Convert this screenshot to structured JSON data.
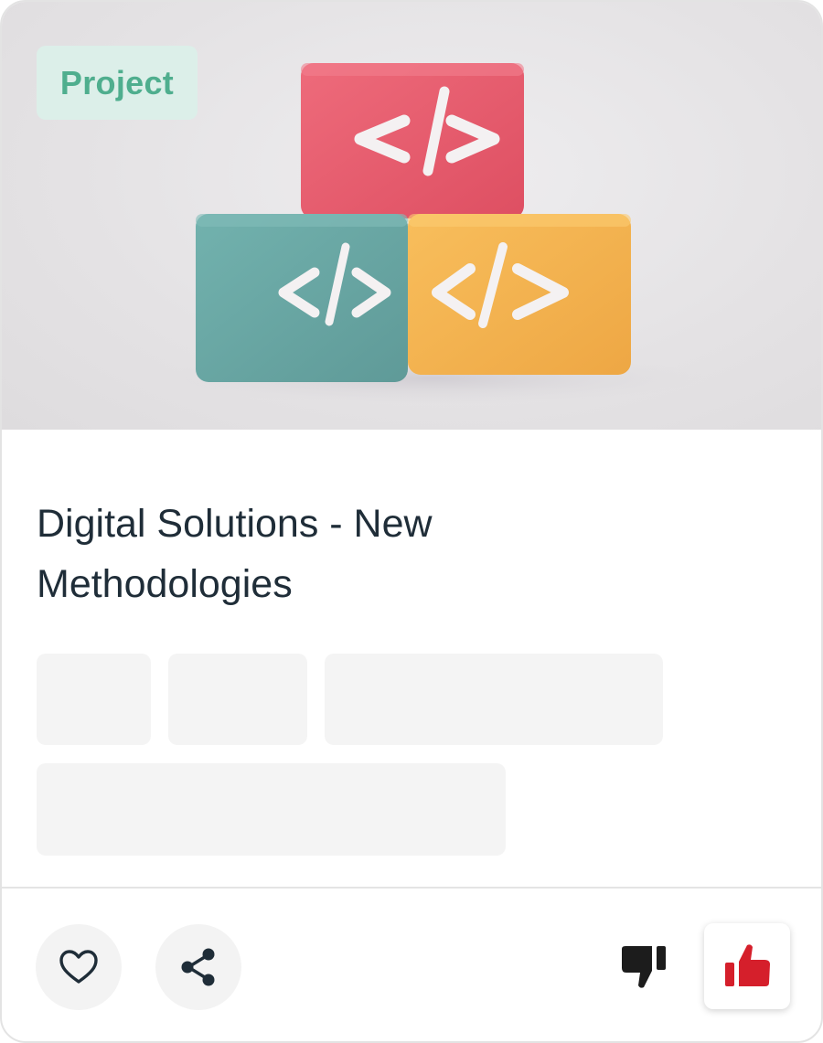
{
  "card": {
    "badge": "Project",
    "title": "Digital Solutions - New Methodologies"
  },
  "hero": {
    "block_glyph": "</>",
    "block_colors": {
      "top": "#e45a6c",
      "left": "#6aa9a6",
      "right": "#f3b24f"
    }
  },
  "actions": {
    "favorite_icon": "heart-icon",
    "share_icon": "share-icon",
    "dislike_icon": "thumbs-down-icon",
    "like_icon": "thumbs-up-icon",
    "like_color": "#d51f2b",
    "dislike_color": "#1c1c1c"
  }
}
